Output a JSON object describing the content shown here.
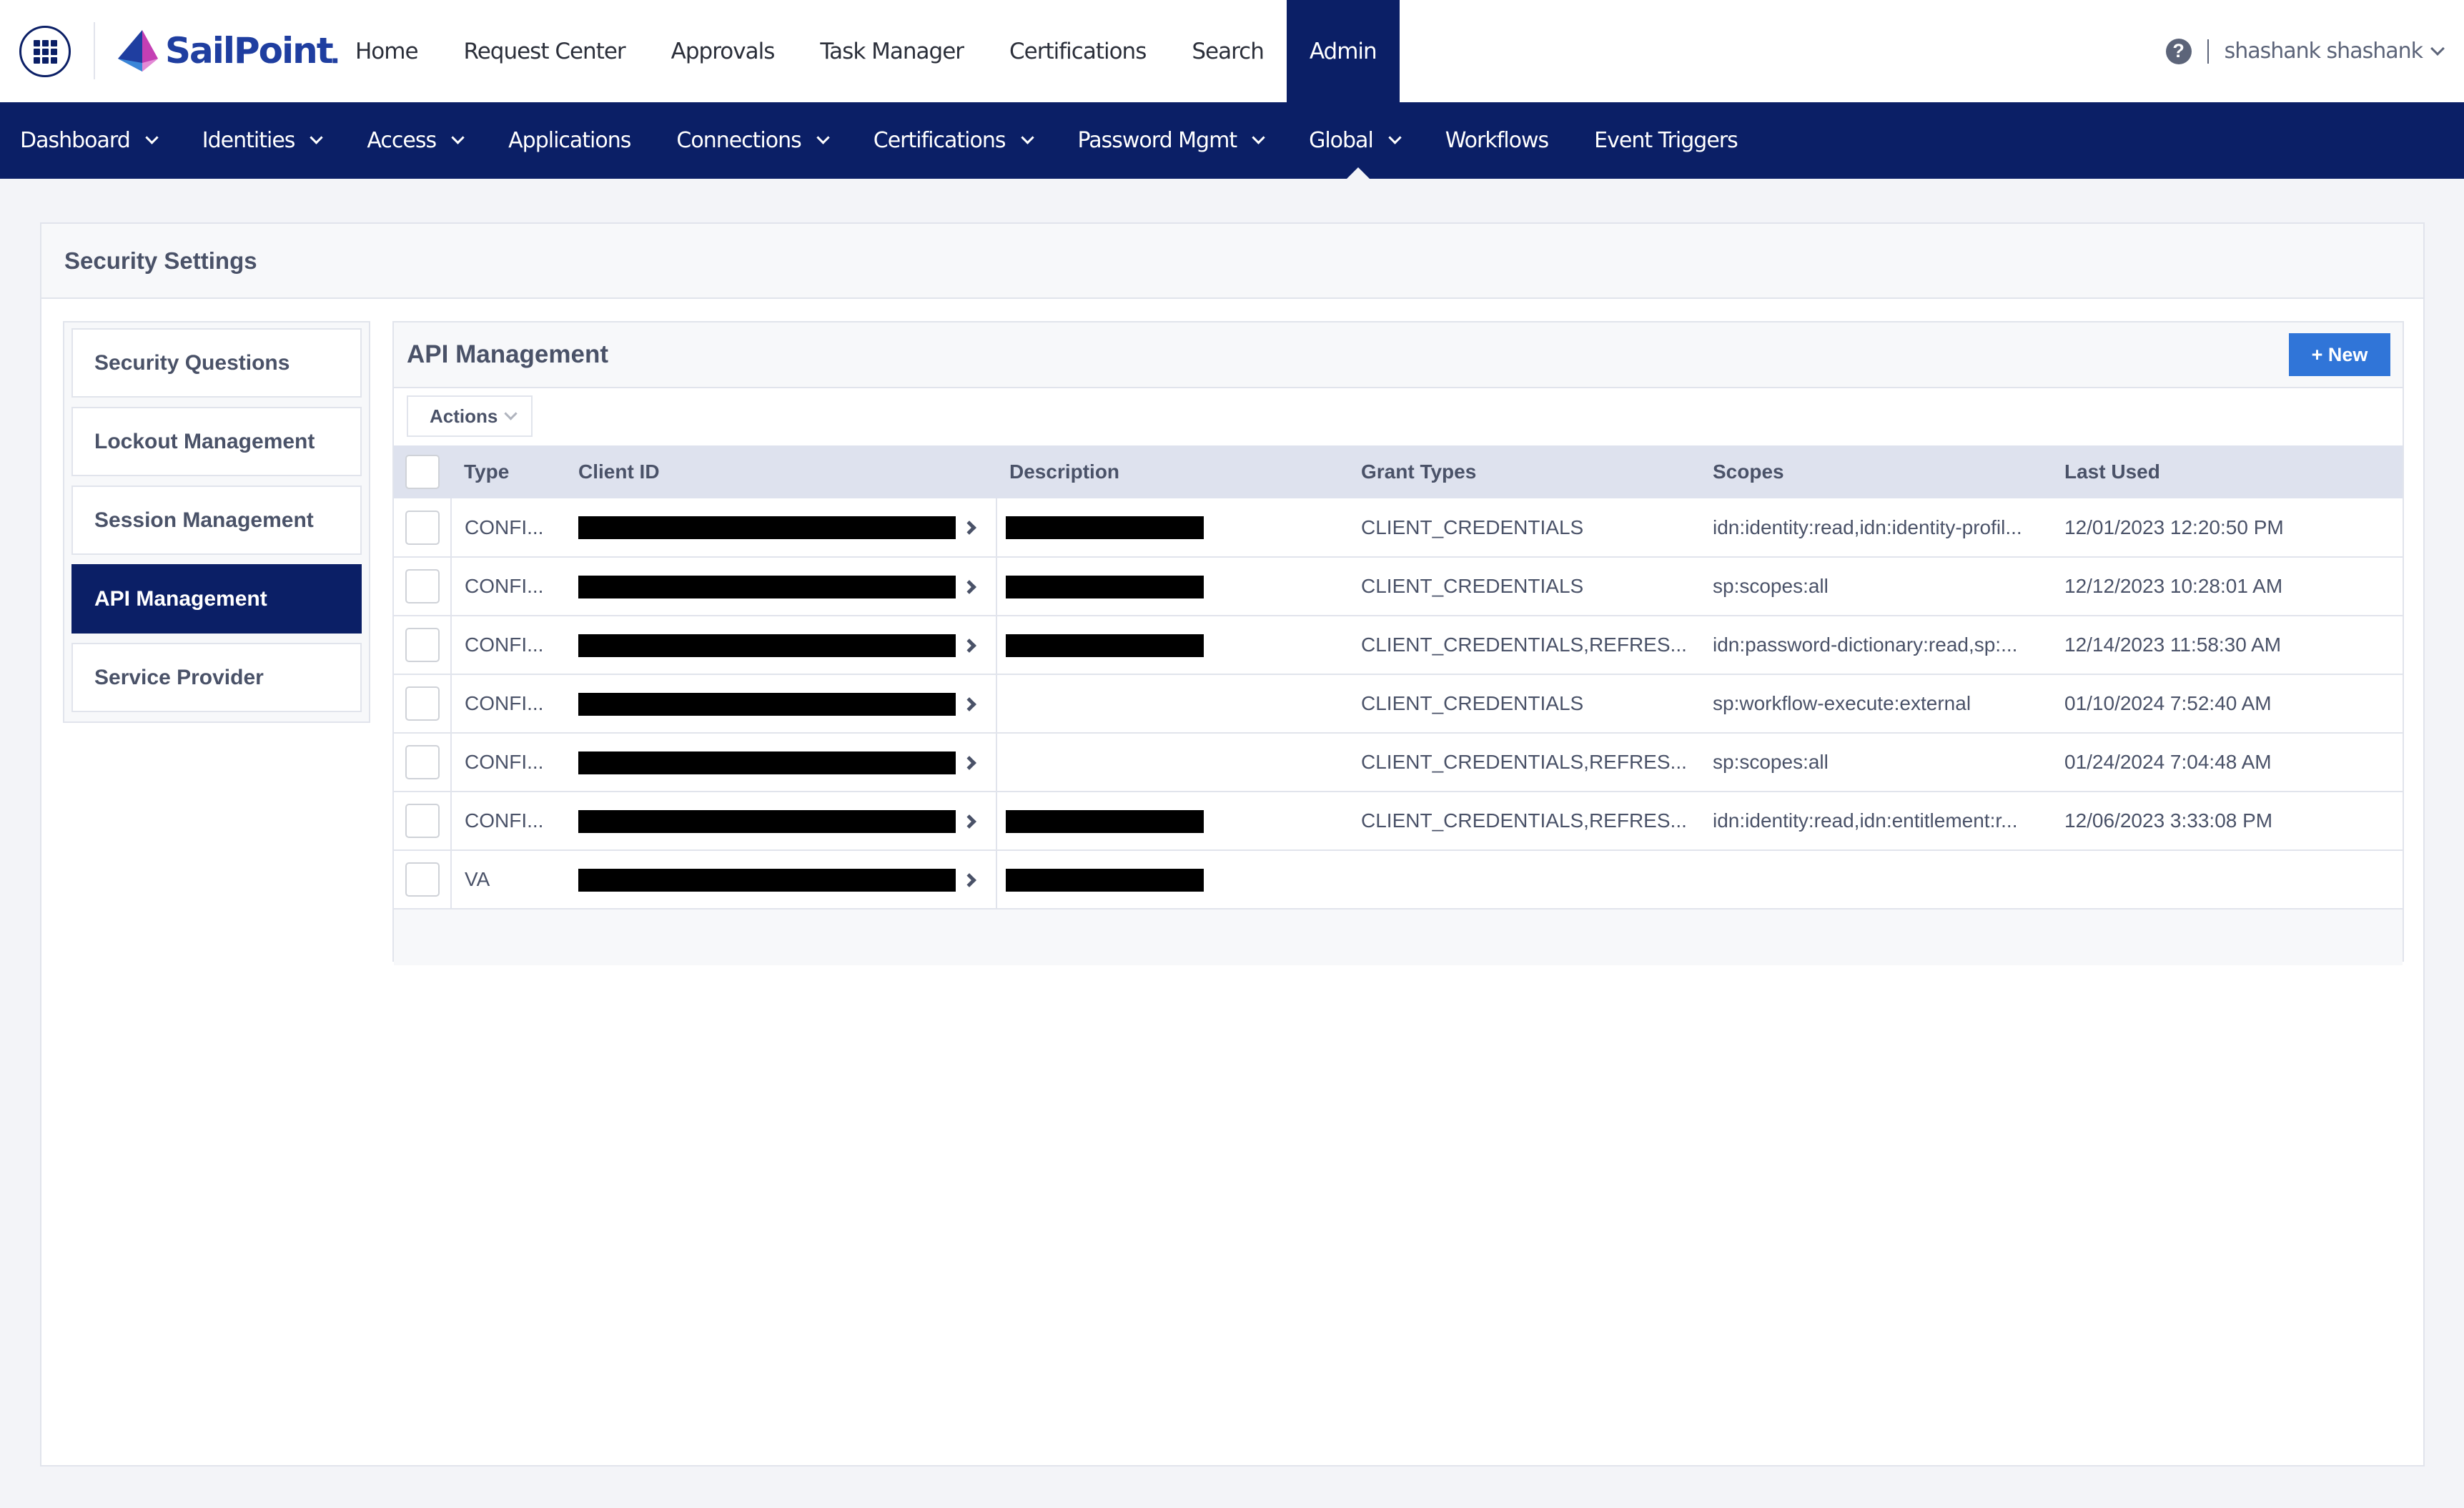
{
  "brand": {
    "name": "SailPoint",
    "accent": "#0b1f66",
    "button_blue": "#3075d8"
  },
  "topnav": {
    "items": [
      {
        "label": "Home"
      },
      {
        "label": "Request Center"
      },
      {
        "label": "Approvals"
      },
      {
        "label": "Task Manager"
      },
      {
        "label": "Certifications"
      },
      {
        "label": "Search"
      },
      {
        "label": "Admin",
        "active": true
      }
    ],
    "user_name": "shashank shashank",
    "help_icon": "?"
  },
  "subnav": {
    "items": [
      {
        "label": "Dashboard",
        "dropdown": true
      },
      {
        "label": "Identities",
        "dropdown": true
      },
      {
        "label": "Access",
        "dropdown": true
      },
      {
        "label": "Applications",
        "dropdown": false
      },
      {
        "label": "Connections",
        "dropdown": true
      },
      {
        "label": "Certifications",
        "dropdown": true
      },
      {
        "label": "Password Mgmt",
        "dropdown": true
      },
      {
        "label": "Global",
        "dropdown": true,
        "active": true
      },
      {
        "label": "Workflows",
        "dropdown": false
      },
      {
        "label": "Event Triggers",
        "dropdown": false
      }
    ]
  },
  "page": {
    "title": "Security Settings"
  },
  "leftnav": {
    "items": [
      {
        "label": "Security Questions"
      },
      {
        "label": "Lockout Management"
      },
      {
        "label": "Session Management"
      },
      {
        "label": "API Management",
        "active": true
      },
      {
        "label": "Service Provider"
      }
    ]
  },
  "panel": {
    "title": "API Management",
    "new_button": "+ New",
    "actions_label": "Actions",
    "columns": [
      "Type",
      "Client ID",
      "Description",
      "Grant Types",
      "Scopes",
      "Last Used"
    ],
    "rows": [
      {
        "type": "CONFI...",
        "client_id": "[redacted]",
        "description": "[redacted]",
        "grant_types": "CLIENT_CREDENTIALS",
        "scopes": "idn:identity:read,idn:identity-profil...",
        "last_used": "12/01/2023 12:20:50 PM"
      },
      {
        "type": "CONFI...",
        "client_id": "[redacted]",
        "description": "[redacted]",
        "grant_types": "CLIENT_CREDENTIALS",
        "scopes": "sp:scopes:all",
        "last_used": "12/12/2023 10:28:01 AM"
      },
      {
        "type": "CONFI...",
        "client_id": "[redacted]",
        "description": "[redacted]",
        "grant_types": "CLIENT_CREDENTIALS,REFRES...",
        "scopes": "idn:password-dictionary:read,sp:...",
        "last_used": "12/14/2023 11:58:30 AM"
      },
      {
        "type": "CONFI...",
        "client_id": "[redacted]",
        "description": "",
        "grant_types": "CLIENT_CREDENTIALS",
        "scopes": "sp:workflow-execute:external",
        "last_used": "01/10/2024 7:52:40 AM"
      },
      {
        "type": "CONFI...",
        "client_id": "[redacted]",
        "description": "",
        "grant_types": "CLIENT_CREDENTIALS,REFRES...",
        "scopes": "sp:scopes:all",
        "last_used": "01/24/2024 7:04:48 AM"
      },
      {
        "type": "CONFI...",
        "client_id": "[redacted]",
        "description": "[redacted]",
        "grant_types": "CLIENT_CREDENTIALS,REFRES...",
        "scopes": "idn:identity:read,idn:entitlement:r...",
        "last_used": "12/06/2023 3:33:08 PM"
      },
      {
        "type": "VA",
        "client_id": "[redacted]",
        "description": "[redacted]",
        "grant_types": "",
        "scopes": "",
        "last_used": ""
      }
    ]
  }
}
